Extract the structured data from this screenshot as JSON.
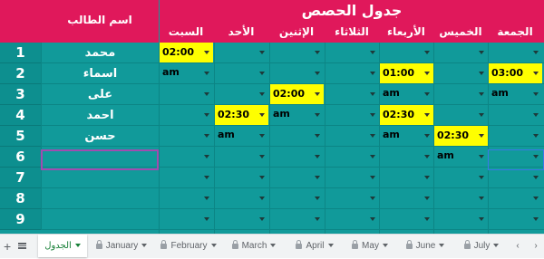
{
  "header": {
    "student_name_label": "اسم الطالب",
    "schedule_title": "جدول الحصص",
    "days": [
      "السبت",
      "الأحد",
      "الإثنين",
      "الثلاثاء",
      "الأربعاء",
      "الخميس",
      "الجمعة"
    ]
  },
  "rows": [
    {
      "num": "1",
      "name": "محمد"
    },
    {
      "num": "2",
      "name": "اسماء"
    },
    {
      "num": "3",
      "name": "على"
    },
    {
      "num": "4",
      "name": "احمد"
    },
    {
      "num": "5",
      "name": "حسن"
    },
    {
      "num": "6",
      "name": ""
    },
    {
      "num": "7",
      "name": ""
    },
    {
      "num": "8",
      "name": ""
    },
    {
      "num": "9",
      "name": ""
    }
  ],
  "times": [
    {
      "row": 0,
      "day": 0,
      "value": "02:00 am"
    },
    {
      "row": 1,
      "day": 4,
      "value": "01:00 am"
    },
    {
      "row": 1,
      "day": 6,
      "value": "03:00 am"
    },
    {
      "row": 2,
      "day": 2,
      "value": "02:00 am"
    },
    {
      "row": 3,
      "day": 1,
      "value": "02:30 am"
    },
    {
      "row": 3,
      "day": 4,
      "value": "02:30 am"
    },
    {
      "row": 4,
      "day": 5,
      "value": "02:30 am"
    }
  ],
  "tabs": {
    "add_icon": "plus-icon",
    "list_icon": "menu-icon",
    "items": [
      {
        "label": "الجدول",
        "active": true,
        "locked": false
      },
      {
        "label": "January",
        "active": false,
        "locked": true
      },
      {
        "label": "February",
        "active": false,
        "locked": true
      },
      {
        "label": "March",
        "active": false,
        "locked": true
      },
      {
        "label": "April",
        "active": false,
        "locked": true
      },
      {
        "label": "May",
        "active": false,
        "locked": true
      },
      {
        "label": "June",
        "active": false,
        "locked": true
      },
      {
        "label": "July",
        "active": false,
        "locked": true
      }
    ]
  },
  "colors": {
    "header": "#e0185b",
    "grid": "#119a9a",
    "time_cell": "#ffff00",
    "active_tab_text": "#188038"
  }
}
